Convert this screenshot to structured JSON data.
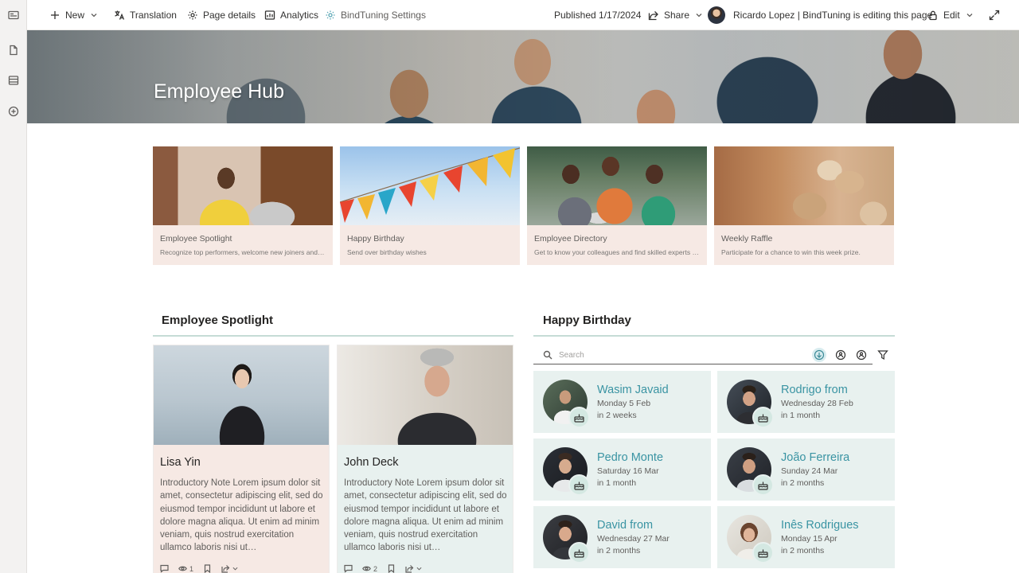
{
  "commandbar": {
    "new_label": "New",
    "translation_label": "Translation",
    "page_details_label": "Page details",
    "analytics_label": "Analytics",
    "bindtuning_label": "BindTuning Settings",
    "published_label": "Published 1/17/2024",
    "share_label": "Share",
    "editing_label": "Ricardo Lopez | BindTuning is editing this page",
    "edit_label": "Edit"
  },
  "hero": {
    "title": "Employee Hub"
  },
  "quick_links": [
    {
      "title": "Employee Spotlight",
      "description": "Recognize top performers, welcome new joiners and celebrate achievements"
    },
    {
      "title": "Happy Birthday",
      "description": "Send over birthday wishes"
    },
    {
      "title": "Employee Directory",
      "description": "Get to know your colleagues and find skilled experts across the company"
    },
    {
      "title": "Weekly Raffle",
      "description": "Participate for a chance to win this week prize."
    }
  ],
  "spotlight": {
    "title": "Employee Spotlight",
    "cards": [
      {
        "name": "Lisa Yin",
        "text": "Introductory Note Lorem ipsum dolor sit amet, consectetur adipiscing elit, sed do eiusmod tempor incididunt ut labore et dolore magna aliqua. Ut enim ad minim veniam, quis nostrud exercitation ullamco laboris nisi ut…",
        "views": "1",
        "bg": "#f6e9e4"
      },
      {
        "name": "John Deck",
        "text": "Introductory Note Lorem ipsum dolor sit amet, consectetur adipiscing elit, sed do eiusmod tempor incididunt ut labore et dolore magna aliqua. Ut enim ad minim veniam, quis nostrud exercitation ullamco laboris nisi ut…",
        "views": "2",
        "bg": "#e8f1ef"
      }
    ]
  },
  "birthday": {
    "title": "Happy Birthday",
    "search_placeholder": "Search",
    "people": [
      {
        "name": "Wasim Javaid",
        "date": "Monday 5 Feb",
        "when": "in 2 weeks"
      },
      {
        "name": "Rodrigo from",
        "date": "Wednesday 28 Feb",
        "when": "in 1 month"
      },
      {
        "name": "Pedro Monte",
        "date": "Saturday 16 Mar",
        "when": "in 1 month"
      },
      {
        "name": "João Ferreira",
        "date": "Sunday 24 Mar",
        "when": "in 2 months"
      },
      {
        "name": "David from",
        "date": "Wednesday 27 Mar",
        "when": "in 2 months"
      },
      {
        "name": "Inês Rodrigues",
        "date": "Monday 15 Apr",
        "when": "in 2 months"
      }
    ]
  },
  "colors": {
    "accent": "#3a94a3",
    "tile_bg": "#f6e9e4",
    "card_bg": "#e8f1ef",
    "divider": "#c5dcd6"
  }
}
